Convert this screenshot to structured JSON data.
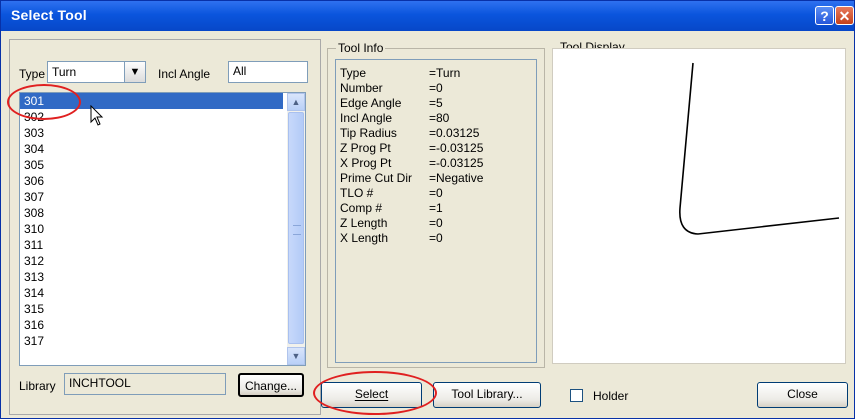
{
  "window": {
    "title": "Select Tool",
    "help_glyph": "?",
    "close_glyph": "✕"
  },
  "left": {
    "type_label": "Type",
    "type_value": "Turn",
    "incl_angle_label": "Incl Angle",
    "incl_angle_value": "All",
    "tools": [
      "301",
      "302",
      "303",
      "304",
      "305",
      "306",
      "307",
      "308",
      "310",
      "311",
      "312",
      "313",
      "314",
      "315",
      "316",
      "317"
    ],
    "library_label": "Library",
    "library_value": "INCHTOOL",
    "change_button": "Change..."
  },
  "tool_info": {
    "legend": "Tool Info",
    "props": [
      {
        "name": "Type",
        "value": "=Turn"
      },
      {
        "name": "Number",
        "value": "=0"
      },
      {
        "name": "Edge Angle",
        "value": "=5"
      },
      {
        "name": "Incl Angle",
        "value": "=80"
      },
      {
        "name": "Tip Radius",
        "value": "=0.03125"
      },
      {
        "name": "Z Prog Pt",
        "value": "=-0.03125"
      },
      {
        "name": "X Prog Pt",
        "value": "=-0.03125"
      },
      {
        "name": "Prime Cut Dir",
        "value": "=Negative"
      },
      {
        "name": "TLO #",
        "value": "=0"
      },
      {
        "name": "Comp #",
        "value": "=1"
      },
      {
        "name": "Z Length",
        "value": "=0"
      },
      {
        "name": "X Length",
        "value": "=0"
      }
    ]
  },
  "tool_display": {
    "legend": "Tool Display"
  },
  "buttons": {
    "select": "Select",
    "tool_library": "Tool Library...",
    "holder": "Holder",
    "close": "Close"
  },
  "icons": {
    "dropdown": "chevron-down-icon",
    "scroll_up": "scroll-up-arrow-icon",
    "scroll_down": "scroll-down-arrow-icon",
    "cursor": "mouse-pointer-icon"
  },
  "colors": {
    "selection": "#316ac5",
    "titlebar": "#0a55dd",
    "highlight": "#e02020"
  }
}
